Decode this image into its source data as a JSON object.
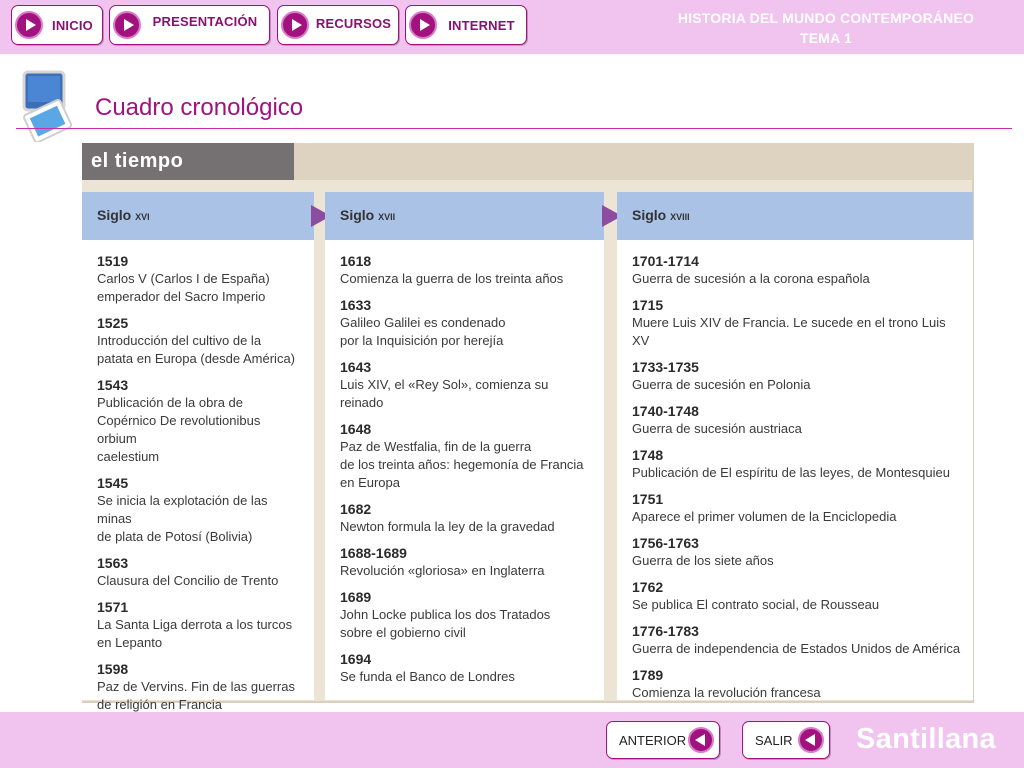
{
  "nav": {
    "inicio": "INICIO",
    "presentacion": "PRESENTACIÓN",
    "recursos": "RECURSOS",
    "internet": "INTERNET"
  },
  "header": {
    "line1": "HISTORIA DEL MUNDO CONTEMPORÁNEO",
    "line2": "TEMA 1"
  },
  "page_title": "Cuadro cronológico",
  "card": {
    "tab": "el tiempo"
  },
  "columns": [
    {
      "label": "Siglo",
      "century": "xvi",
      "events": [
        {
          "year": "1519",
          "text": "Carlos V (Carlos I de España)\nemperador del Sacro Imperio"
        },
        {
          "year": "1525",
          "text": "Introducción del cultivo de la\npatata en Europa (desde América)"
        },
        {
          "year": "1543",
          "text": "Publicación de la obra de\nCopérnico De revolutionibus orbium\ncaelestium"
        },
        {
          "year": "1545",
          "text": "Se inicia la explotación de las minas\nde plata de Potosí (Bolivia)"
        },
        {
          "year": "1563",
          "text": "Clausura del Concilio de Trento"
        },
        {
          "year": "1571",
          "text": "La Santa Liga derrota a los turcos\nen Lepanto"
        },
        {
          "year": "1598",
          "text": "Paz de Vervins. Fin de las guerras\nde religión en Francia"
        }
      ]
    },
    {
      "label": "Siglo",
      "century": "xvii",
      "events": [
        {
          "year": "1618",
          "text": "Comienza la guerra de los treinta años"
        },
        {
          "year": "1633",
          "text": "Galileo Galilei es condenado\npor la Inquisición por herejía"
        },
        {
          "year": "1643",
          "text": "Luis XIV, el «Rey Sol», comienza su reinado"
        },
        {
          "year": "1648",
          "text": "Paz de Westfalia, fin de la guerra\nde los treinta años: hegemonía de Francia\nen Europa"
        },
        {
          "year": "1682",
          "text": "Newton formula la ley de la gravedad"
        },
        {
          "year": "1688-1689",
          "text": "Revolución «gloriosa» en Inglaterra"
        },
        {
          "year": "1689",
          "text": "John Locke publica los dos Tratados\nsobre el gobierno civil"
        },
        {
          "year": "1694",
          "text": "Se funda el Banco de Londres"
        }
      ]
    },
    {
      "label": "Siglo",
      "century": "xviii",
      "events": [
        {
          "year": "1701-1714",
          "text": "Guerra de sucesión a la corona española"
        },
        {
          "year": "1715",
          "text": "Muere Luis XIV de Francia. Le sucede en el trono Luis XV"
        },
        {
          "year": "1733-1735",
          "text": "Guerra de sucesión en Polonia"
        },
        {
          "year": "1740-1748",
          "text": "Guerra de sucesión austriaca"
        },
        {
          "year": "1748",
          "text": "Publicación de El espíritu de las leyes, de Montesquieu"
        },
        {
          "year": "1751",
          "text": "Aparece el primer volumen de la Enciclopedia"
        },
        {
          "year": "1756-1763",
          "text": "Guerra de los siete años"
        },
        {
          "year": "1762",
          "text": "Se publica El contrato social, de Rousseau"
        },
        {
          "year": "1776-1783",
          "text": "Guerra de independencia de Estados Unidos de América"
        },
        {
          "year": "1789",
          "text": "Comienza la revolución francesa"
        }
      ]
    }
  ],
  "footer": {
    "anterior": "ANTERIOR",
    "salir": "SALIR",
    "brand": "Santillana"
  },
  "colors": {
    "accent": "#a1127f",
    "bar": "#f1c3ef",
    "column_header": "#a9c2e6",
    "arrow": "#8c4da0",
    "tab": "#757172"
  },
  "icons": {
    "nav": "play-circle-icon",
    "footer": "back-circle-icon",
    "title": "slides-icon"
  }
}
